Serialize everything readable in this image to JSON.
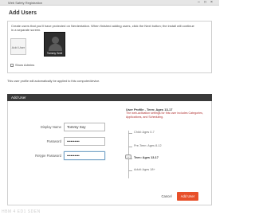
{
  "window": {
    "title": "Web Safety Registration"
  },
  "dialog": {
    "title": "Add Users"
  },
  "instructions": {
    "text": "Create users that you'll have protected on Nerdentation. When finished adding users, click the Next button; the install will continue in a separate screen."
  },
  "users": {
    "add_user_label": "Add User",
    "profiles": [
      {
        "name": "Tommy Smit"
      }
    ],
    "show_admins_label": "Show Admins"
  },
  "note": {
    "text": "This user profile will automatically be applied to this computer/device."
  },
  "add_user_section": {
    "title": "Add User",
    "fields": {
      "name_label": "Display Name",
      "name_value": "Tommy Soy",
      "password_label": "Password",
      "password_value": "••••••••••",
      "retype_label": "Retype Password",
      "retype_value": "••••••••••"
    },
    "rating": {
      "title": "User Profile - Teen: Ages 13-17",
      "description": "The web-activation settings for this user includes Categories, Applications, and Scheduling.",
      "levels": [
        "Child: Ages 0-7",
        "Pre-Teen: Ages 8-12",
        "Teen: Ages 13-17",
        "Adult: Ages 18+"
      ],
      "selected_index": 2,
      "handle_glyph": "‹›"
    },
    "buttons": {
      "cancel": "Cancel",
      "add": "Add User"
    }
  },
  "watermark": {
    "text": "HBM 4 ED1 SDEN"
  },
  "colors": {
    "accent": "#e8502a",
    "section_bar": "#3a3a3a",
    "rating_desc": "#b03030"
  }
}
